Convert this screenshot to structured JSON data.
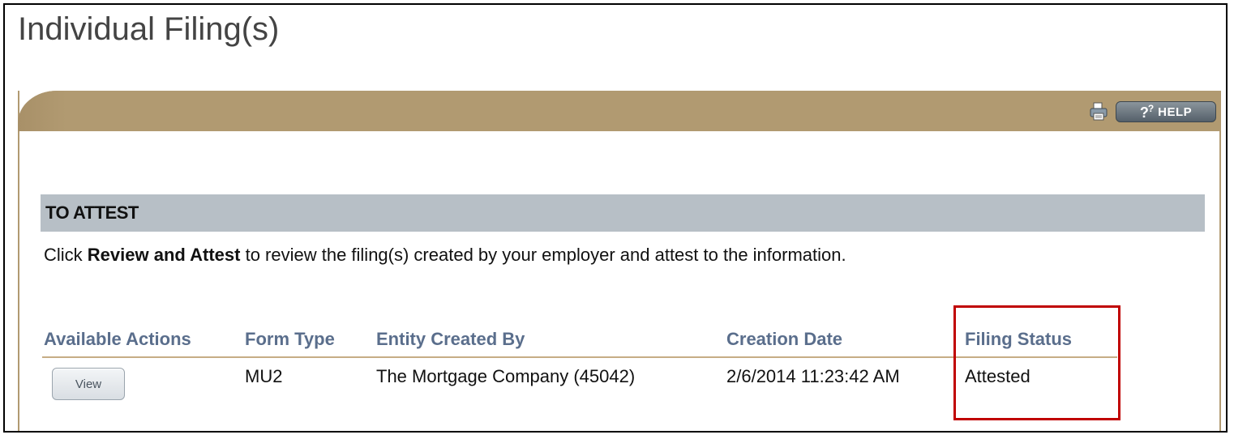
{
  "page": {
    "title": "Individual Filing(s)"
  },
  "panel": {
    "help_label": "HELP",
    "help_icon_text": "??",
    "printer_icon": "printer-icon",
    "header_color": "#b19a71"
  },
  "section": {
    "title": "TO ATTEST",
    "instructions_prefix": "Click ",
    "instructions_bold": "Review and Attest",
    "instructions_suffix": " to review the filing(s) created by your employer and attest to the information.",
    "bar_color": "#b7bfc6"
  },
  "table": {
    "columns": [
      "Available Actions",
      "Form Type",
      "Entity Created By",
      "Creation Date",
      "Filing Status"
    ],
    "rows": [
      {
        "action_label": "View",
        "form_type": "MU2",
        "entity": "The Mortgage Company (45042)",
        "creation_date": "2/6/2014 11:23:42 AM",
        "status": "Attested"
      }
    ],
    "header_color": "#5a6e8c",
    "highlight_color": "#c00000"
  }
}
